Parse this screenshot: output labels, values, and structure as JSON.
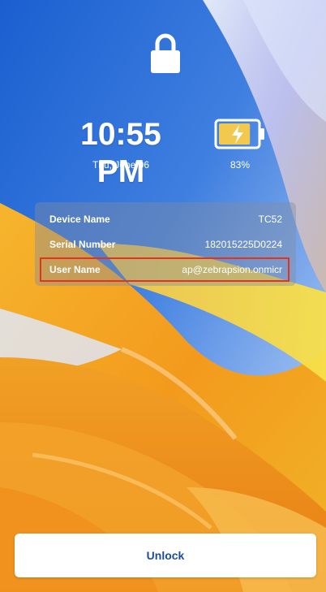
{
  "lock_screen": {
    "time": "10:55 PM",
    "date": "Thu, June 06",
    "battery_percent_text": "83%",
    "battery_level": 0.83,
    "battery_status": "charging"
  },
  "device_info": {
    "rows": [
      {
        "label": "Device Name",
        "value": "TC52"
      },
      {
        "label": "Serial Number",
        "value": "182015225D0224"
      },
      {
        "label": "User Name",
        "value": "ap@zebrapsion.onmicr"
      }
    ]
  },
  "actions": {
    "unlock_label": "Unlock"
  },
  "icons": {
    "lock": "lock-icon",
    "battery": "battery-charging-icon"
  },
  "colors": {
    "battery_fill": "#f2c94c",
    "highlight_border": "#e5321a",
    "unlock_text": "#1b4d9c"
  }
}
